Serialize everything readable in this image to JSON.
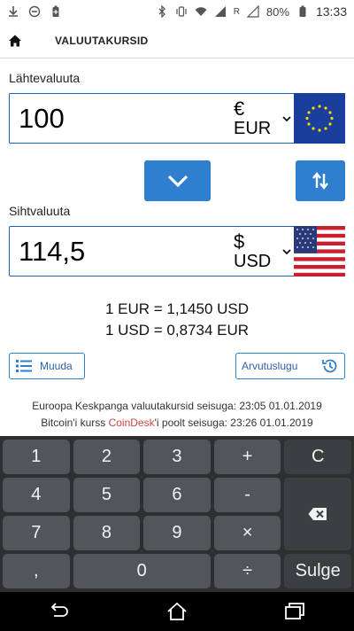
{
  "status_bar": {
    "battery": "80%",
    "time": "13:33",
    "signal_indicator": "R"
  },
  "header": {
    "title": "VALUUTAKURSID"
  },
  "source": {
    "label": "Lähtevaluuta",
    "amount": "100",
    "symbol": "€",
    "code": "EUR",
    "flag": "eu-flag-icon"
  },
  "target": {
    "label": "Sihtvaluuta",
    "amount": "114,5",
    "symbol": "$",
    "code": "USD",
    "flag": "us-flag-icon"
  },
  "rates": {
    "line1": "1 EUR  =  1,1450 USD",
    "line2": "1 USD  =  0,8734 EUR"
  },
  "buttons": {
    "more_label": "Muuda",
    "history_label": "Arvutuslugu"
  },
  "sources": {
    "ecb_line": "Euroopa Keskpanga valuutakursid seisuga: 23:05 01.01.2019",
    "btc_prefix": "Bitcoin'i kurss ",
    "btc_brand": "CoinDesk",
    "btc_suffix": "'i poolt seisuga: 23:26 01.01.2019"
  },
  "keypad": {
    "k1": "1",
    "k2": "2",
    "k3": "3",
    "plus": "+",
    "clear": "C",
    "k4": "4",
    "k5": "5",
    "k6": "6",
    "minus": "-",
    "k7": "7",
    "k8": "8",
    "k9": "9",
    "times": "×",
    "comma": ",",
    "k0": "0",
    "divide": "÷",
    "close": "Sulge"
  },
  "colors": {
    "accent": "#2e7fd0",
    "keypad_bg": "#2d2f31",
    "key_bg": "#52565a",
    "coindesk": "#d04545"
  }
}
